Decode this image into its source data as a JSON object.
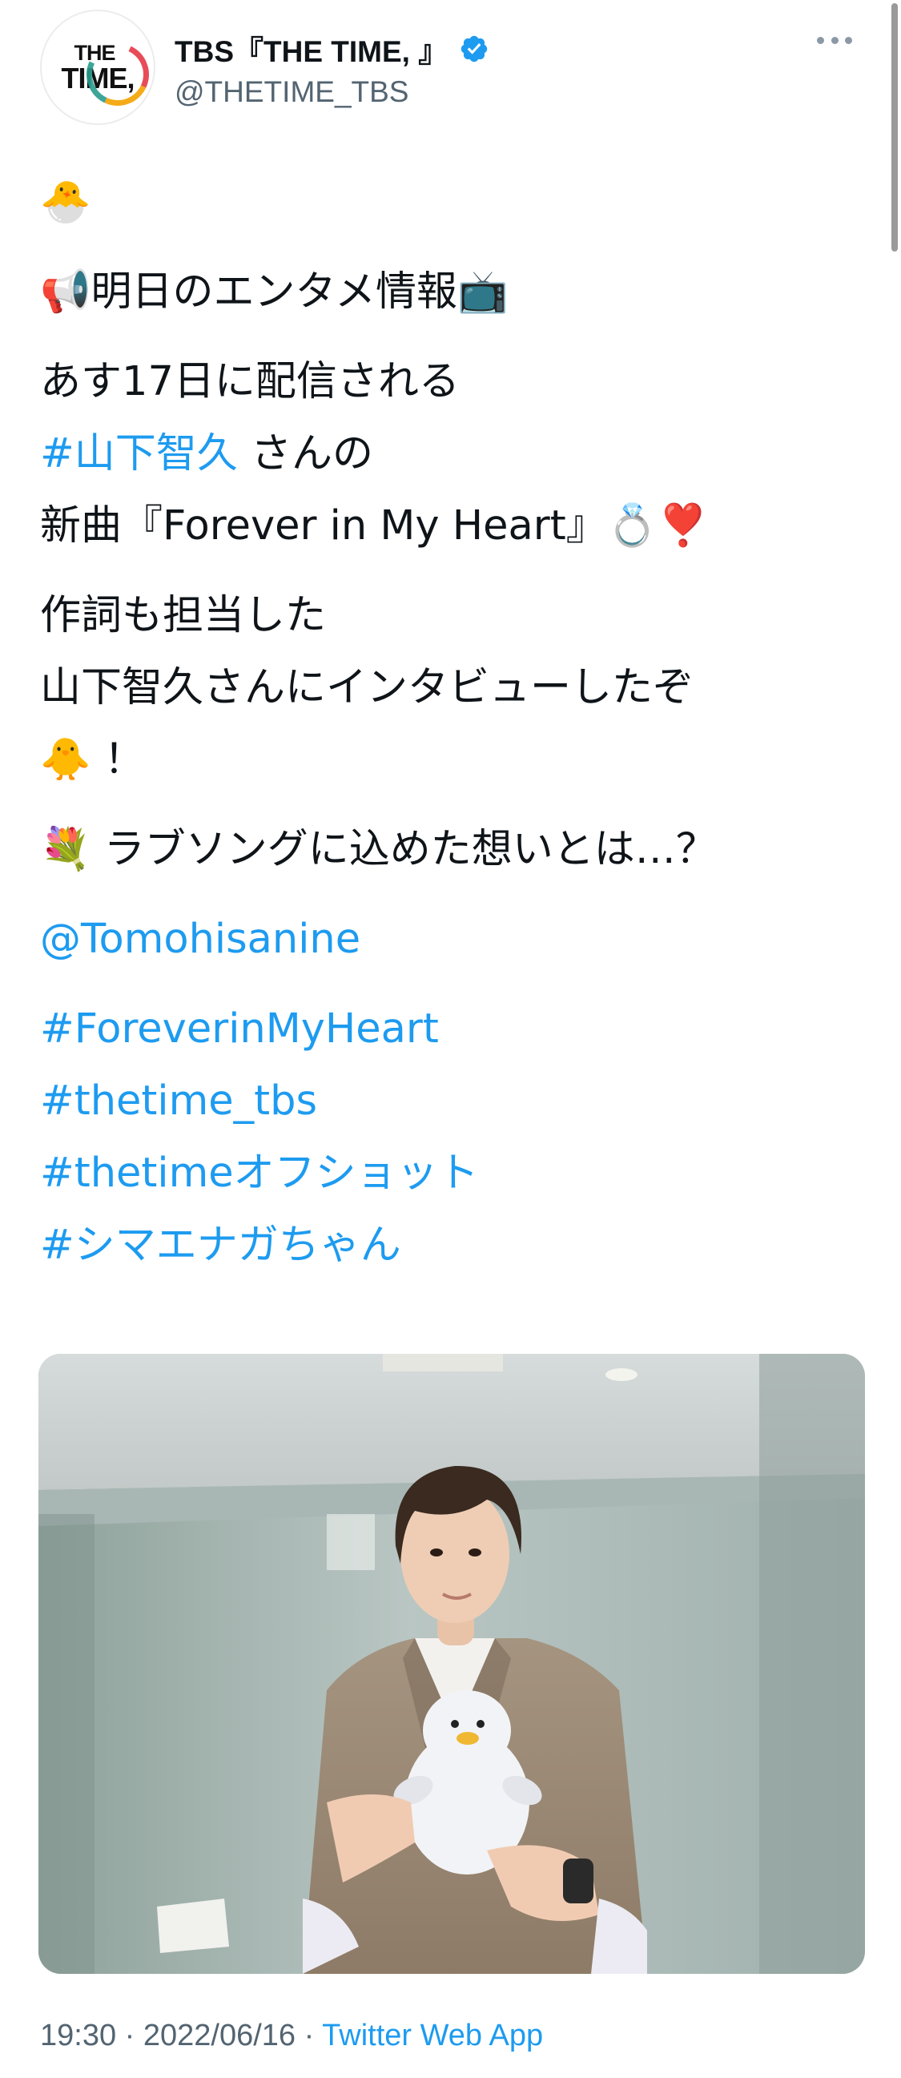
{
  "account": {
    "display_name": "TBS『THE TIME, 』",
    "handle": "@THETIME_TBS",
    "avatar_logo_top": "THE",
    "avatar_logo_bottom": "TIME,"
  },
  "tweet": {
    "line1": "🐣",
    "line2": "📢明日のエンタメ情報📺",
    "line3": "あす17日に配信される",
    "line4_link": "#山下智久",
    "line4_rest": " さんの",
    "line5": "新曲『Forever in My Heart』💍❣️",
    "line6": "作詞も担当した",
    "line7": "山下智久さんにインタビューしたぞ",
    "line8": "🐥 ！",
    "line9": "💐 ラブソングに込めた想いとは…？",
    "mention": "@Tomohisanine",
    "hashtags": [
      "#ForeverinMyHeart",
      "#thetime_tbs",
      "#thetimeオフショット",
      "#シマエナガちゃん"
    ]
  },
  "meta": {
    "time": "19:30",
    "sep1": " · ",
    "date": "2022/06/16",
    "sep2": " · ",
    "source": "Twitter Web App"
  },
  "colors": {
    "link": "#1d9bf0",
    "secondary_text": "#536471",
    "verified_badge": "#1d9bf0"
  },
  "icons": {
    "verified": "verified-badge-icon",
    "more": "more-dots-icon"
  }
}
